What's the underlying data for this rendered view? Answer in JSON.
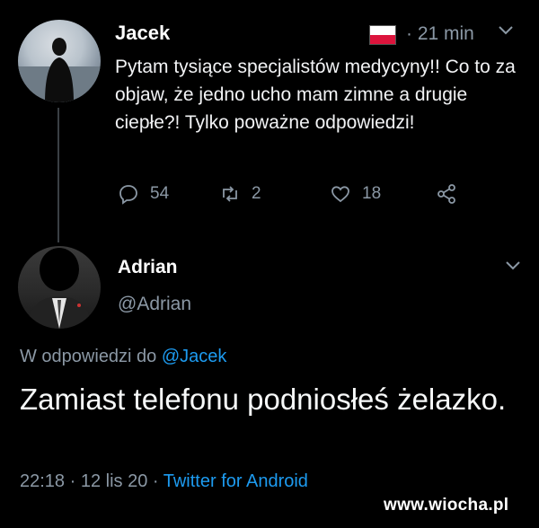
{
  "original_tweet": {
    "author_name": "Jacek",
    "time_ago": "21 min",
    "text": "Pytam tysiące specjalistów medycyny!! Co to za objaw, że jedno ucho mam zimne a drugie ciepłe?! Tylko poważne odpowiedzi!",
    "reply_count": "54",
    "retweet_count": "2",
    "like_count": "18",
    "flag_colors": [
      "#ffffff",
      "#dc143c"
    ]
  },
  "reply_tweet": {
    "author_name": "Adrian",
    "handle": "@Adrian",
    "replying_to_prefix": "W odpowiedzi do",
    "replying_to_mention": "@Jacek",
    "text": "Zamiast telefonu podniosłeś żelazko.",
    "timestamp": "22:18 · 12 lis 20 ·",
    "source_app": "Twitter for Android"
  },
  "watermark": "www.wiocha.pl",
  "icons": [
    "reply-icon",
    "retweet-icon",
    "like-icon",
    "share-icon",
    "chevron-down-icon"
  ],
  "colors": {
    "background": "#000000",
    "text": "#e7e9ea",
    "muted": "#8b98a5",
    "link": "#1d9bf0"
  }
}
